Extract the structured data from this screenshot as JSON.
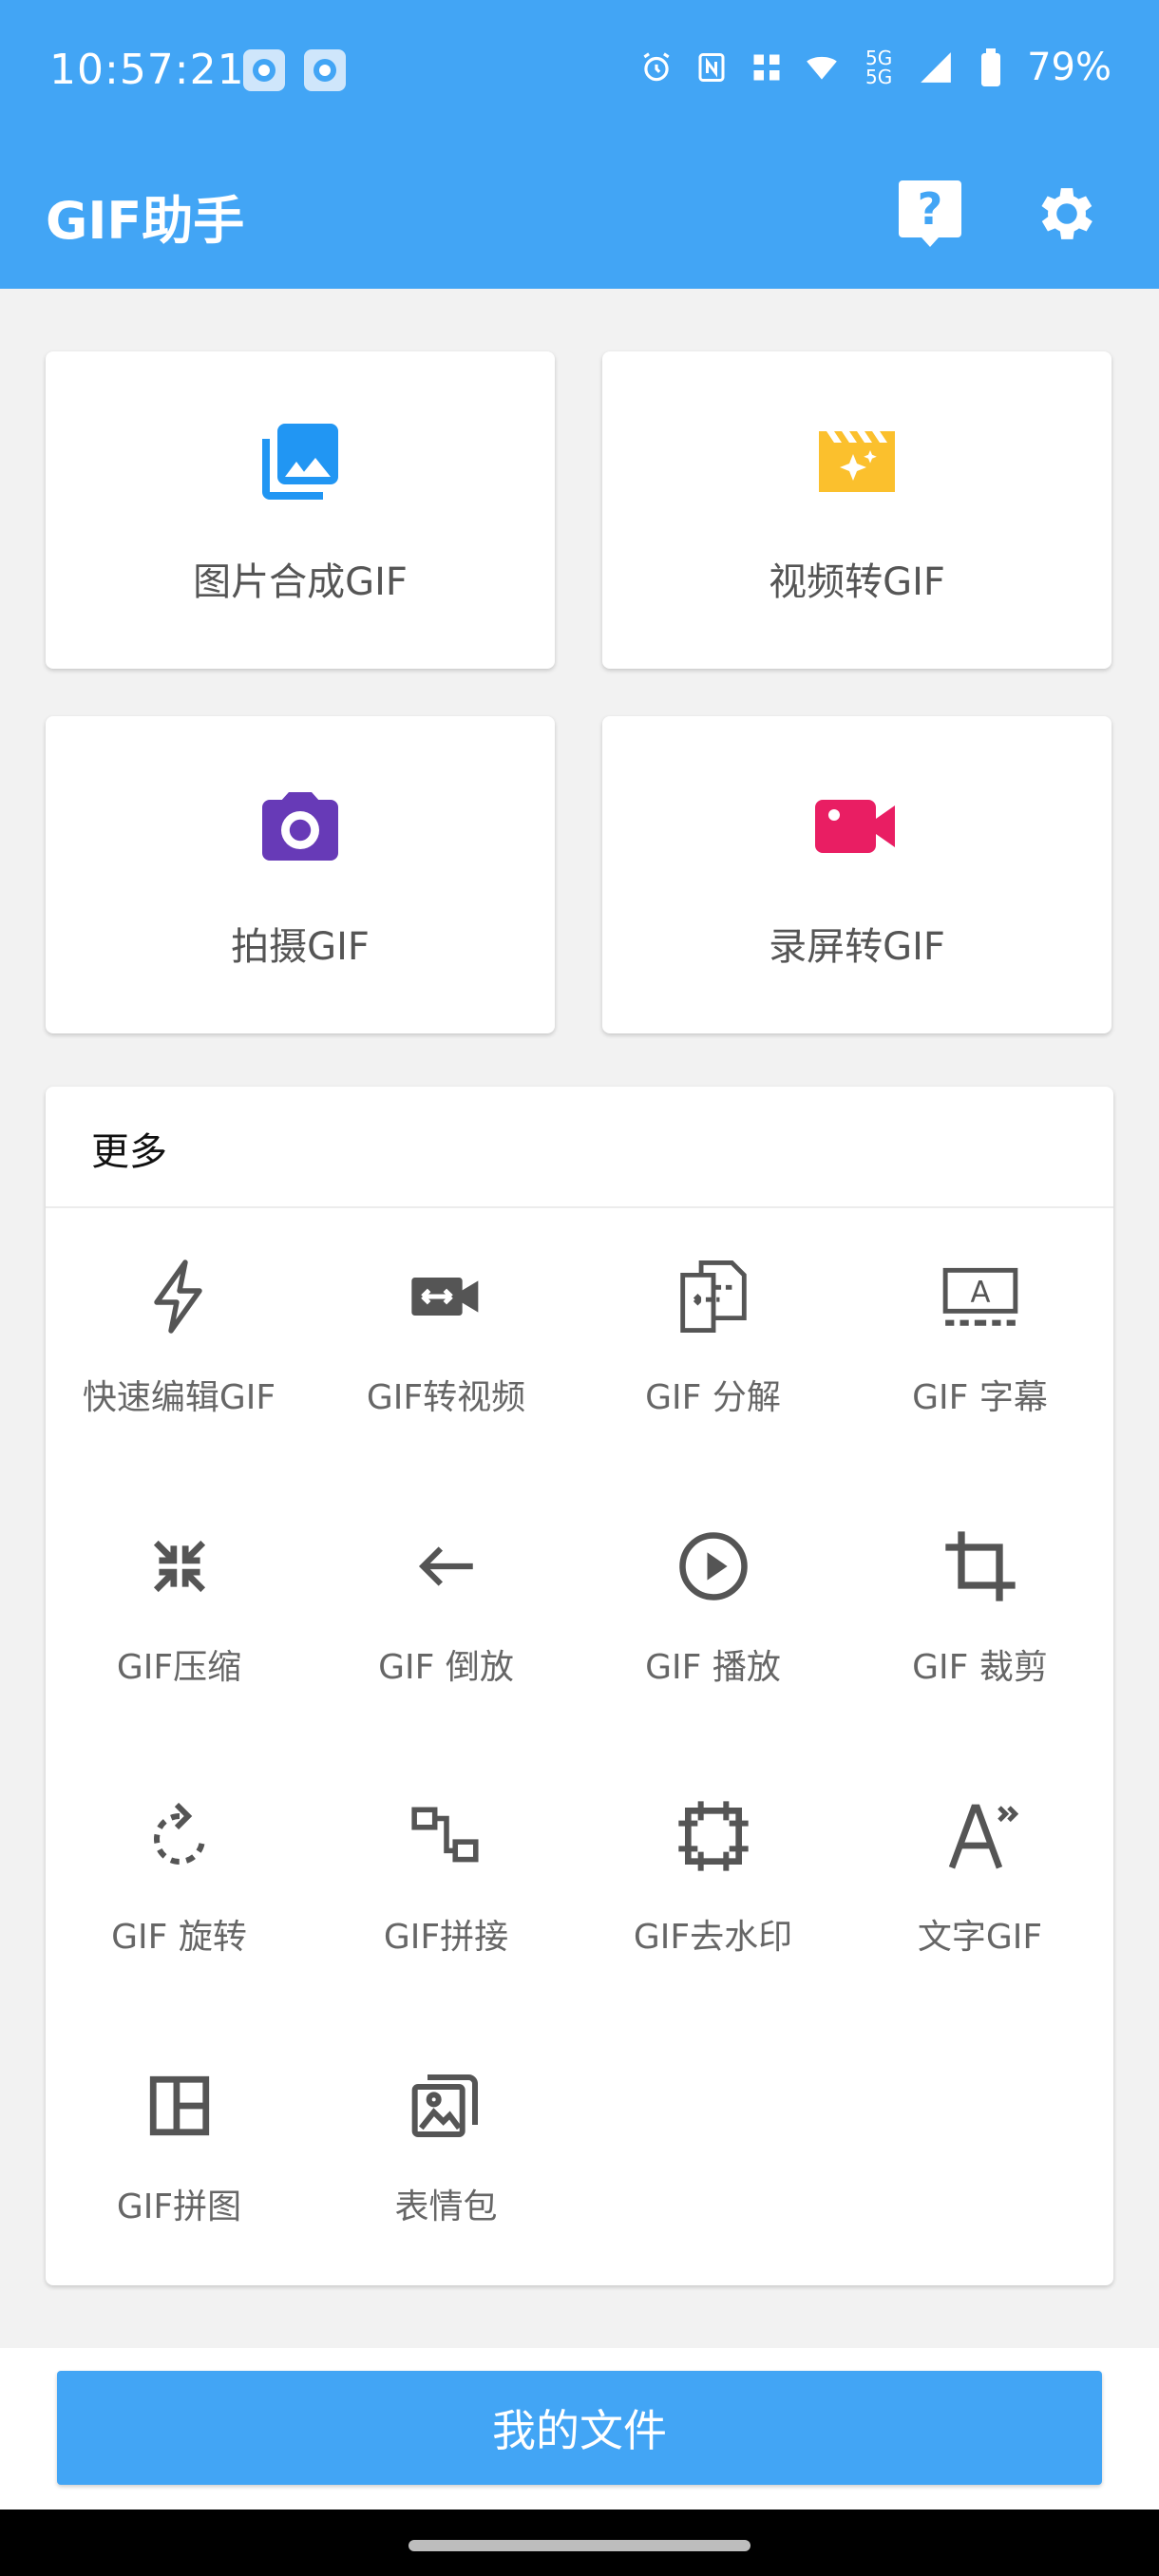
{
  "status": {
    "time": "10:57:21",
    "battery": "79%",
    "network": "5G 5G"
  },
  "appbar": {
    "title": "GIF助手",
    "help_icon": "help-icon",
    "settings_icon": "gear-icon"
  },
  "main_cards": [
    {
      "label": "图片合成GIF",
      "icon": "image-stack-icon",
      "color": "#2196f3"
    },
    {
      "label": "视频转GIF",
      "icon": "movie-clapper-icon",
      "color": "#fbc02d"
    },
    {
      "label": "拍摄GIF",
      "icon": "camera-icon",
      "color": "#673ab7"
    },
    {
      "label": "录屏转GIF",
      "icon": "video-camera-icon",
      "color": "#e91e63"
    }
  ],
  "more": {
    "title": "更多",
    "items": [
      {
        "label": "快速编辑GIF",
        "icon": "flash-icon"
      },
      {
        "label": "GIF转视频",
        "icon": "video-convert-icon"
      },
      {
        "label": "GIF 分解",
        "icon": "split-icon"
      },
      {
        "label": "GIF 字幕",
        "icon": "subtitle-icon"
      },
      {
        "label": "GIF压缩",
        "icon": "compress-icon"
      },
      {
        "label": "GIF 倒放",
        "icon": "arrow-left-icon"
      },
      {
        "label": "GIF 播放",
        "icon": "play-circle-icon"
      },
      {
        "label": "GIF 裁剪",
        "icon": "crop-icon"
      },
      {
        "label": "GIF 旋转",
        "icon": "rotate-icon"
      },
      {
        "label": "GIF拼接",
        "icon": "join-icon"
      },
      {
        "label": "GIF去水印",
        "icon": "watermark-remove-icon"
      },
      {
        "label": "文字GIF",
        "icon": "text-icon"
      },
      {
        "label": "GIF拼图",
        "icon": "collage-icon"
      },
      {
        "label": "表情包",
        "icon": "sticker-icon"
      }
    ]
  },
  "bottom": {
    "my_files": "我的文件"
  },
  "colors": {
    "primary": "#42a5f5",
    "icon_gray": "#555555"
  }
}
